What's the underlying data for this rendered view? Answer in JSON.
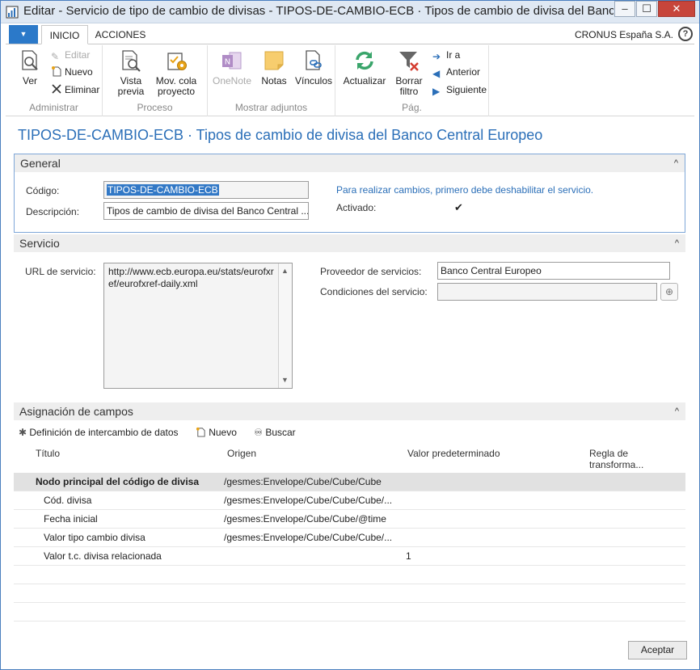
{
  "window": {
    "title": "Editar - Servicio de tipo de cambio de divisas - TIPOS-DE-CAMBIO-ECB · Tipos de cambio de divisa del Banc...",
    "min_glyph": "–",
    "max_glyph": "☐",
    "close_glyph": "✕"
  },
  "tabs": {
    "menu_glyph": "▼",
    "inicio": "INICIO",
    "acciones": "ACCIONES",
    "company": "CRONUS España S.A.",
    "help_glyph": "?"
  },
  "ribbon": {
    "administrar": {
      "label": "Administrar",
      "ver": "Ver",
      "editar": "Editar",
      "nuevo": "Nuevo",
      "eliminar": "Eliminar"
    },
    "proceso": {
      "label": "Proceso",
      "vista_previa_1": "Vista",
      "vista_previa_2": "previa",
      "mov_cola_1": "Mov. cola",
      "mov_cola_2": "proyecto"
    },
    "adjuntos": {
      "label": "Mostrar adjuntos",
      "onenote": "OneNote",
      "notas": "Notas",
      "vinculos": "Vínculos"
    },
    "pag": {
      "label": "Pág.",
      "actualizar": "Actualizar",
      "borrar_1": "Borrar",
      "borrar_2": "filtro",
      "ir_a": "Ir a",
      "anterior": "Anterior",
      "siguiente": "Siguiente"
    }
  },
  "page_title": "TIPOS-DE-CAMBIO-ECB · Tipos de cambio de divisa del Banco Central Europeo",
  "general": {
    "header": "General",
    "caret": "^",
    "codigo_label": "Código:",
    "codigo_value": "TIPOS-DE-CAMBIO-ECB",
    "descripcion_label": "Descripción:",
    "descripcion_value": "Tipos de cambio de divisa del Banco Central ...",
    "notice": "Para realizar cambios, primero debe deshabilitar el servicio.",
    "activado_label": "Activado:",
    "activado_glyph": "✔"
  },
  "servicio": {
    "header": "Servicio",
    "caret": "^",
    "url_label": "URL de servicio:",
    "url_value": "http://www.ecb.europa.eu/stats/eurofxref/eurofxref-daily.xml",
    "proveedor_label": "Proveedor de servicios:",
    "proveedor_value": "Banco Central Europeo",
    "condiciones_label": "Condiciones del servicio:",
    "condiciones_value": "",
    "globe_glyph": "⊕"
  },
  "asignacion": {
    "header": "Asignación de campos",
    "caret": "^",
    "toolbar": {
      "definicion": "Definición de intercambio de datos",
      "nuevo": "Nuevo",
      "buscar": "Buscar"
    },
    "columns": {
      "titulo": "Título",
      "origen": "Origen",
      "valor": "Valor predeterminado",
      "regla_1": "Regla de",
      "regla_2": "transforma..."
    },
    "rows": [
      {
        "titulo": "Nodo principal del código de divisa",
        "origen": "/gesmes:Envelope/Cube/Cube/Cube",
        "valor": ""
      },
      {
        "titulo": "Cód. divisa",
        "origen": "/gesmes:Envelope/Cube/Cube/Cube/...",
        "valor": ""
      },
      {
        "titulo": "Fecha inicial",
        "origen": "/gesmes:Envelope/Cube/Cube/@time",
        "valor": ""
      },
      {
        "titulo": "Valor tipo cambio divisa",
        "origen": "/gesmes:Envelope/Cube/Cube/Cube/...",
        "valor": ""
      },
      {
        "titulo": "Valor t.c. divisa relacionada",
        "origen": "",
        "valor": "1"
      }
    ]
  },
  "footer": {
    "aceptar": "Aceptar"
  }
}
